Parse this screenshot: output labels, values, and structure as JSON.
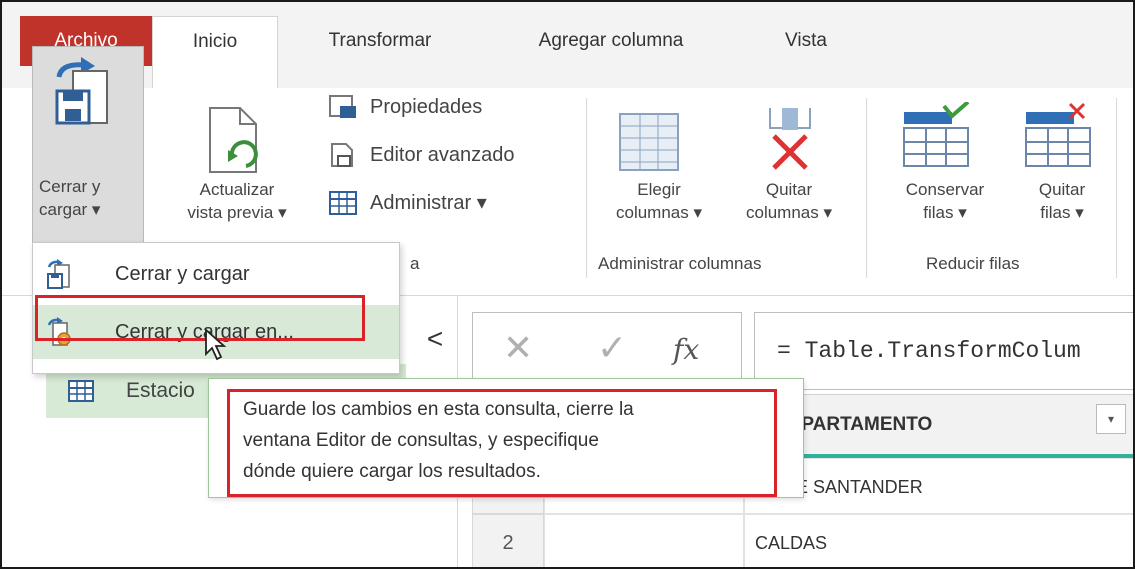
{
  "tabs": [
    {
      "label": "Archivo"
    },
    {
      "label": "Inicio"
    },
    {
      "label": "Transformar"
    },
    {
      "label": "Agregar columna"
    },
    {
      "label": "Vista"
    }
  ],
  "ribbon": {
    "close_load": {
      "label": "Cerrar y\ncargar ▾",
      "icon": "close-load-icon"
    },
    "refresh_preview": {
      "label": "Actualizar\nvista previa ▾",
      "icon": "refresh-icon"
    },
    "properties": {
      "label": "Propiedades",
      "icon": "properties-icon"
    },
    "advanced_editor": {
      "label": "Editor avanzado",
      "icon": "advanced-editor-icon"
    },
    "manage": {
      "label": "Administrar ▾",
      "icon": "table-icon"
    },
    "choose_columns": {
      "label": "Elegir\ncolumnas ▾",
      "icon": "choose-columns-icon"
    },
    "remove_columns": {
      "label": "Quitar\ncolumnas ▾",
      "icon": "remove-columns-icon"
    },
    "keep_rows": {
      "label": "Conservar\nfilas ▾",
      "icon": "keep-rows-icon"
    },
    "remove_rows": {
      "label": "Quitar\nfilas ▾",
      "icon": "remove-rows-icon"
    },
    "groups": {
      "query_partial": "a",
      "manage_columns": "Administrar columnas",
      "reduce_rows": "Reducir filas"
    }
  },
  "dropdown": {
    "items": [
      {
        "label": "Cerrar y cargar",
        "icon": "close-load-icon"
      },
      {
        "label": "Cerrar y cargar en...",
        "icon": "close-load-to-icon"
      }
    ]
  },
  "queries": {
    "collapse_glyph": "<",
    "item_label": "Estacio",
    "dots": "· ·"
  },
  "formula_bar": {
    "cancel_glyph": "✕",
    "confirm_glyph": "✓",
    "fx_label": "fx",
    "formula": "= Table.TransformColum"
  },
  "grid": {
    "column_header": "DEPARTAMENTO",
    "filter_glyph": "▾",
    "rows": [
      {
        "index": "",
        "value": "TE DE SANTANDER"
      },
      {
        "index": "2",
        "value": "CALDAS"
      }
    ]
  },
  "tooltip": {
    "line1": "Guarde los cambios en esta consulta, cierre la",
    "line2": "ventana Editor de consultas, y especifique",
    "line3": "dónde quiere cargar los resultados."
  },
  "colors": {
    "archivo_tab": "#c0332b",
    "highlight_outline": "#d9232a",
    "selected_item": "#d8e9d8",
    "column_accent": "#2eb39a"
  }
}
